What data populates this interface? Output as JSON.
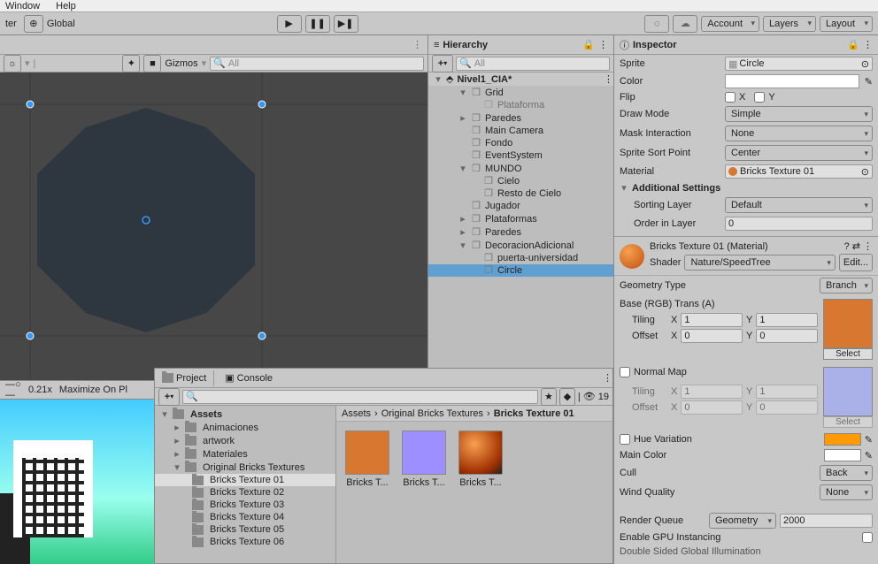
{
  "menubar": {
    "item1": "Window",
    "item2": "Help"
  },
  "topbar": {
    "handLabel": "ter",
    "globalLabel": "Global",
    "accountLabel": "Account",
    "layersLabel": "Layers",
    "layoutLabel": "Layout"
  },
  "scene": {
    "gizmosLabel": "Gizmos",
    "searchPlaceholder": "All",
    "zoom": "0.21x",
    "maximizeLabel": "Maximize On Pl"
  },
  "hierarchy": {
    "title": "Hierarchy",
    "searchPlaceholder": "All",
    "sceneName": "Nivel1_CIA*",
    "items": [
      {
        "name": "Grid",
        "indent": 2,
        "exp": "▾"
      },
      {
        "name": "Plataforma",
        "indent": 3,
        "exp": "",
        "dim": true
      },
      {
        "name": "Paredes",
        "indent": 2,
        "exp": "▸"
      },
      {
        "name": "Main Camera",
        "indent": 2,
        "exp": ""
      },
      {
        "name": "Fondo",
        "indent": 2,
        "exp": ""
      },
      {
        "name": "EventSystem",
        "indent": 2,
        "exp": ""
      },
      {
        "name": "MUNDO",
        "indent": 2,
        "exp": "▾"
      },
      {
        "name": "Cielo",
        "indent": 3,
        "exp": ""
      },
      {
        "name": "Resto de Cielo",
        "indent": 3,
        "exp": ""
      },
      {
        "name": "Jugador",
        "indent": 2,
        "exp": ""
      },
      {
        "name": "Plataformas",
        "indent": 2,
        "exp": "▸"
      },
      {
        "name": "Paredes",
        "indent": 2,
        "exp": "▸"
      },
      {
        "name": "DecoracionAdicional",
        "indent": 2,
        "exp": "▾"
      },
      {
        "name": "puerta-universidad",
        "indent": 3,
        "exp": ""
      },
      {
        "name": "Circle",
        "indent": 3,
        "exp": "",
        "selected": true
      }
    ]
  },
  "inspector": {
    "title": "Inspector",
    "spriteLabel": "Sprite",
    "spriteValue": "Circle",
    "colorLabel": "Color",
    "colorValue": "#ffffff",
    "flipLabel": "Flip",
    "flipX": "X",
    "flipY": "Y",
    "drawModeLabel": "Draw Mode",
    "drawModeValue": "Simple",
    "maskLabel": "Mask Interaction",
    "maskValue": "None",
    "sortPointLabel": "Sprite Sort Point",
    "sortPointValue": "Center",
    "materialLabel": "Material",
    "materialValue": "Bricks Texture 01",
    "additionalLabel": "Additional Settings",
    "sortLayerLabel": "Sorting Layer",
    "sortLayerValue": "Default",
    "orderLabel": "Order in Layer",
    "orderValue": "0",
    "matName": "Bricks Texture 01 (Material)",
    "shaderLabel": "Shader",
    "shaderValue": "Nature/SpeedTree",
    "editLabel": "Edit...",
    "geomLabel": "Geometry Type",
    "geomValue": "Branch",
    "baseRgbLabel": "Base (RGB) Trans (A)",
    "tilingLabel": "Tiling",
    "offsetLabel": "Offset",
    "tilX": "1",
    "tilY": "1",
    "offX": "0",
    "offY": "0",
    "xLabel": "X",
    "yLabel": "Y",
    "selectLabel": "Select",
    "normalMapLabel": "Normal Map",
    "nTilX": "1",
    "nTilY": "1",
    "nOffX": "0",
    "nOffY": "0",
    "hueLabel": "Hue Variation",
    "hueColor": "#ff9a00",
    "mainColorLabel": "Main Color",
    "mainColor": "#ffffff",
    "cullLabel": "Cull",
    "cullValue": "Back",
    "windLabel": "Wind Quality",
    "windValue": "None",
    "renderQueueLabel": "Render Queue",
    "renderQueueMode": "Geometry",
    "renderQueueValue": "2000",
    "gpuLabel": "Enable GPU Instancing",
    "doubleSidedLabel": "Double Sided Global Illumination"
  },
  "project": {
    "projectTab": "Project",
    "consoleTab": "Console",
    "searchCount": "19",
    "assetsLabel": "Assets",
    "folders": [
      "Animaciones",
      "artwork",
      "Materiales",
      "Original Bricks Textures"
    ],
    "bricks": [
      "Bricks Texture 01",
      "Bricks Texture 02",
      "Bricks Texture 03",
      "Bricks Texture 04",
      "Bricks Texture 05",
      "Bricks Texture 06"
    ],
    "crumb1": "Assets",
    "crumb2": "Original Bricks Textures",
    "crumb3": "Bricks Texture 01",
    "thumbs": [
      "Bricks T...",
      "Bricks T...",
      "Bricks T..."
    ]
  }
}
